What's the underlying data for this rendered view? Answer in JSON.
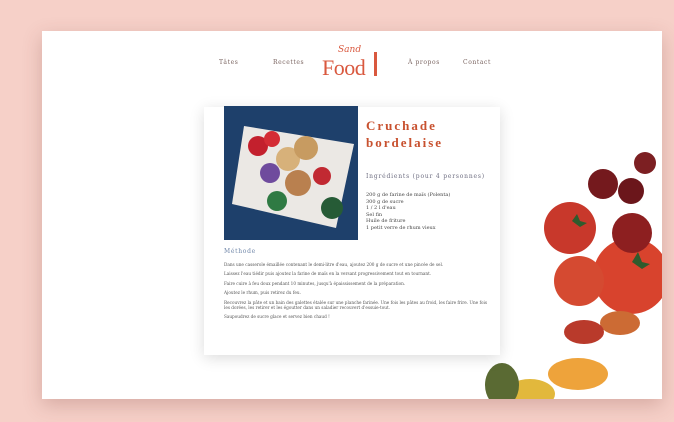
{
  "nav": {
    "items": [
      "Tâtes",
      "Recettes",
      "À propos",
      "Contact"
    ]
  },
  "logo": {
    "word": "Food",
    "script": "Sand"
  },
  "recipe": {
    "title_line1": "Cruchade",
    "title_line2": "bordelaise",
    "ingredients_heading": "Ingrédients (pour 4 personnes)",
    "ingredients": [
      "200 g de farine de maïs (Polenta)",
      "300 g de sucre",
      "1 / 2 l d'eau",
      "Sel fin",
      "Huile de friture",
      "1 petit verre de rhum vieux"
    ],
    "method_heading": "Méthode",
    "steps": [
      "Dans une casserole émaillée contenant le demi-litre d'eau, ajoutez 200 g de sucre et une pincée de sel.",
      "Laissez l'eau tiédir puis ajoutez la farine de maïs en la versant progressivement tout en tournant.",
      "Faire cuire à feu doux pendant 10 minutes, jusqu'à épaississement de la préparation.",
      "Ajoutez le rhum, puis retirez du feu.",
      "Recouvrez la pâte et un bain des galettes étalée sur une planche farinée. Une fois les pâtes au froid, les faire frire. Une fois les dorées, les retirer et les égoutter dans un saladier recouvert d'essuie-tout.",
      "Saupoudrez de sucre glace et servez bien chaud !"
    ]
  },
  "colors": {
    "background": "#f6d0c8",
    "accent": "#d9583e",
    "method": "#6f86a8"
  },
  "icons": [
    "tomatoes-illustration",
    "food-photo"
  ]
}
